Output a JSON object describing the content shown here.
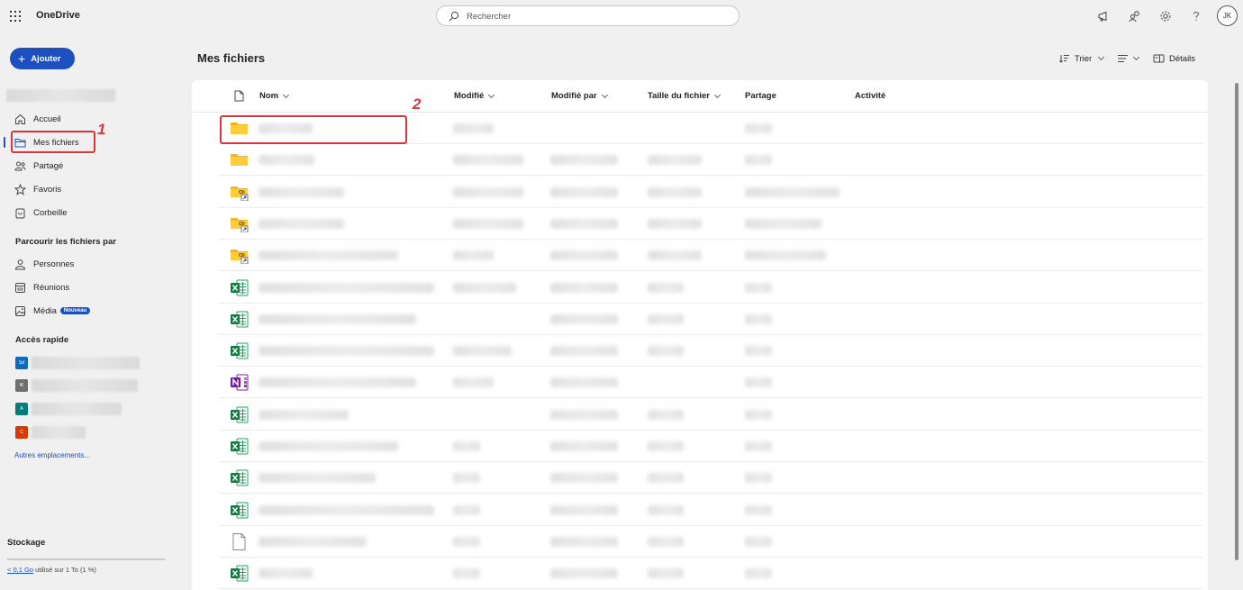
{
  "app": {
    "name": "OneDrive"
  },
  "search": {
    "placeholder": "Rechercher"
  },
  "user": {
    "initials": "JK"
  },
  "sidebar": {
    "add_label": "Ajouter",
    "nav": [
      {
        "label": "Accueil",
        "icon": "home-icon"
      },
      {
        "label": "Mes fichiers",
        "icon": "folder-icon"
      },
      {
        "label": "Partagé",
        "icon": "people-icon"
      },
      {
        "label": "Favoris",
        "icon": "star-icon"
      },
      {
        "label": "Corbeille",
        "icon": "trash-icon"
      }
    ],
    "browse_title": "Parcourir les fichiers par",
    "browse": [
      {
        "label": "Personnes",
        "icon": "person-icon"
      },
      {
        "label": "Réunions",
        "icon": "calendar-icon"
      },
      {
        "label": "Média",
        "icon": "image-icon",
        "badge": "Nouveau"
      }
    ],
    "quick_title": "Accès rapide",
    "quick_access": [
      {
        "abbr": "Sd",
        "color": "#0f6cbd"
      },
      {
        "abbr": "IK",
        "color": "#6e6e6e"
      },
      {
        "abbr": "A",
        "color": "#037c7c"
      },
      {
        "abbr": "C",
        "color": "#d83b01"
      }
    ],
    "more_label": "Autres emplacements...",
    "storage_title": "Stockage",
    "storage_used": "< 0,1 Go",
    "storage_rest": " utilisé sur 1 To (1 %)"
  },
  "main": {
    "title": "Mes fichiers",
    "sort_label": "Trier",
    "details_label": "Détails",
    "columns": {
      "name": "Nom",
      "modified": "Modifié",
      "modified_by": "Modifié par",
      "size": "Taille du fichier",
      "sharing": "Partage",
      "activity": "Activité"
    },
    "rows": [
      {
        "type": "folder"
      },
      {
        "type": "folder"
      },
      {
        "type": "shared-folder"
      },
      {
        "type": "shared-folder"
      },
      {
        "type": "shared-folder"
      },
      {
        "type": "excel"
      },
      {
        "type": "excel"
      },
      {
        "type": "excel"
      },
      {
        "type": "onenote"
      },
      {
        "type": "excel"
      },
      {
        "type": "excel"
      },
      {
        "type": "excel"
      },
      {
        "type": "excel"
      },
      {
        "type": "file"
      },
      {
        "type": "excel"
      }
    ]
  },
  "annotations": [
    "1",
    "2"
  ]
}
